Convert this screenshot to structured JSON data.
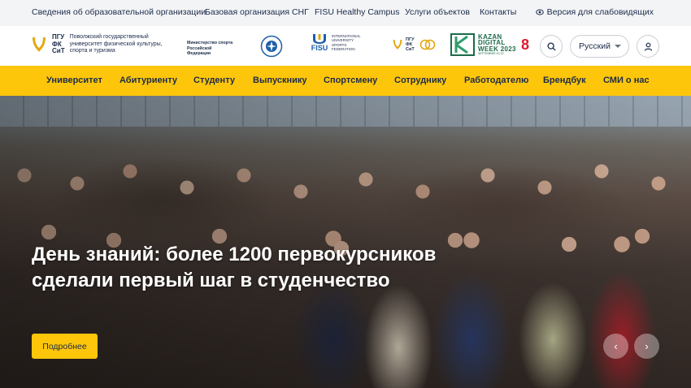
{
  "topbar": {
    "links": [
      "Сведения об образовательной организации",
      "Базовая организация СНГ",
      "FISU Healthy Campus",
      "Услуги объектов",
      "Контакты"
    ],
    "vision_label": "Версия для слабовидящих",
    "vision_icon": "eye-icon"
  },
  "header": {
    "logo_abbr": [
      "ПГУ",
      "ФК",
      "СиТ"
    ],
    "logo_text": "Поволжский государственный университет физической культуры, спорта и туризма",
    "ministry": "Министерство спорта Российской Федерации",
    "fisu_name": "FISU",
    "fisu_full": "INTERNATIONAL UNIVERSITY SPORTS FEDERATION",
    "pguf_small": "ПГУ ФК СиТ",
    "kazan_lines": [
      "KAZAN",
      "DIGITAL",
      "WEEK 2023"
    ],
    "kazan_sub": "SEPTEMBER 20-22",
    "eight": "8",
    "language": "Русский",
    "icons": {
      "search": "search-icon",
      "user": "user-icon",
      "caret": "chevron-down-icon"
    }
  },
  "nav": {
    "items": [
      "Университет",
      "Абитуриенту",
      "Студенту",
      "Выпускнику",
      "Спортсмену",
      "Сотруднику",
      "Работодателю",
      "Брендбук",
      "СМИ о нас"
    ]
  },
  "hero": {
    "title": "День знаний: более 1200 первокурсников сделали первый шаг в студенчество",
    "button": "Подробнее",
    "prev": "‹",
    "next": "›"
  },
  "colors": {
    "accent": "#fdc60b",
    "text": "#1c2b4a",
    "topbar_bg": "#f3f4f6",
    "eight_red": "#e0192e",
    "kazan_green": "#1c6b4a"
  }
}
